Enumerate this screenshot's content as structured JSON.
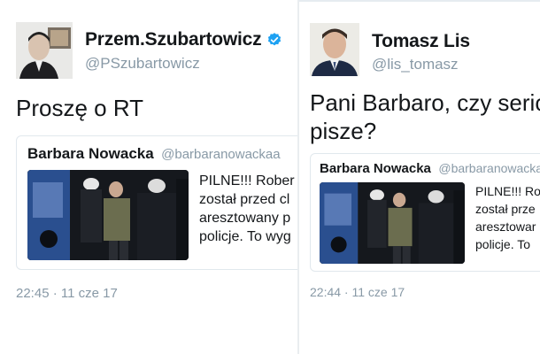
{
  "left_tweet": {
    "display_name": "Przem.Szubartowicz",
    "handle": "@PSzubartowicz",
    "verified": true,
    "avatar_icon": "person-avatar-icon",
    "text": "Proszę o RT",
    "quoted": {
      "name": "Barbara Nowacka",
      "handle": "@barbaranowackaa",
      "text_lines": [
        "PILNE!!! Rober",
        "został przed cl",
        "aresztowany p",
        "policje. To wyg"
      ]
    },
    "timestamp": "22:45 · 11 cze 17"
  },
  "right_tweet": {
    "display_name": "Tomasz Lis",
    "handle": "@lis_tomasz",
    "avatar_icon": "person-avatar-icon",
    "text_lines": [
      "Pani Barbaro, czy serio? T",
      "pisze?"
    ],
    "quoted": {
      "name": "Barbara Nowacka",
      "handle": "@barbaranowackaa",
      "text_lines": [
        "PILNE!!! Ro",
        "został prze",
        "aresztowar",
        "policje. To"
      ]
    },
    "timestamp": "22:44 · 11 cze 17"
  },
  "colors": {
    "text_primary": "#14171a",
    "text_secondary": "#8899a6",
    "verified_blue": "#1da1f2",
    "border": "#e1e8ed"
  },
  "icons": {
    "verified": "verified-badge-icon",
    "photo": "arrest-photo-icon"
  }
}
